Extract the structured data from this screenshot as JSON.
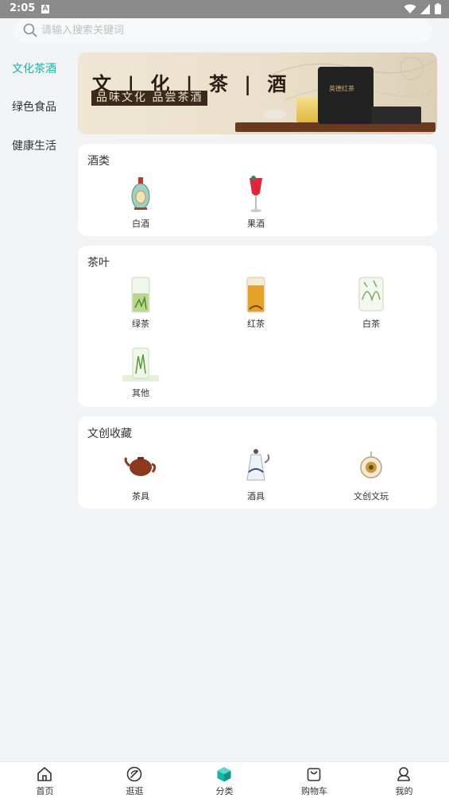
{
  "status_bar": {
    "time": "2:05",
    "notification_icon": "A"
  },
  "search": {
    "placeholder": "请输入搜索关键词",
    "value": ""
  },
  "sidebar": {
    "items": [
      {
        "label": "文化茶酒",
        "active": true
      },
      {
        "label": "绿色食品",
        "active": false
      },
      {
        "label": "健康生活",
        "active": false
      }
    ]
  },
  "banner": {
    "title": "文 | 化 | 茶 | 酒",
    "subtitle": "品味文化 品尝茶酒",
    "package_text": "英德红茶"
  },
  "sections": [
    {
      "title": "酒类",
      "items": [
        {
          "label": "白酒",
          "icon": "baijiu-bottle-icon"
        },
        {
          "label": "果酒",
          "icon": "fruit-wine-glass-icon"
        }
      ]
    },
    {
      "title": "茶叶",
      "items": [
        {
          "label": "绿茶",
          "icon": "green-tea-glass-icon"
        },
        {
          "label": "红茶",
          "icon": "black-tea-glass-icon"
        },
        {
          "label": "白茶",
          "icon": "white-tea-glass-icon"
        },
        {
          "label": "其他",
          "icon": "other-tea-glass-icon"
        }
      ]
    },
    {
      "title": "文创收藏",
      "items": [
        {
          "label": "茶具",
          "icon": "teapot-icon"
        },
        {
          "label": "酒具",
          "icon": "wine-vessel-icon"
        },
        {
          "label": "文创文玩",
          "icon": "collectible-ornament-icon"
        }
      ]
    }
  ],
  "tabbar": {
    "tabs": [
      {
        "label": "首页",
        "icon": "home-icon"
      },
      {
        "label": "逛逛",
        "icon": "compass-icon"
      },
      {
        "label": "分类",
        "icon": "category-cube-icon",
        "active": true
      },
      {
        "label": "购物车",
        "icon": "shopping-bag-icon"
      },
      {
        "label": "我的",
        "icon": "user-icon"
      }
    ]
  },
  "colors": {
    "accent": "#16b3a6",
    "background": "#f2f3f5",
    "card": "#ffffff"
  }
}
